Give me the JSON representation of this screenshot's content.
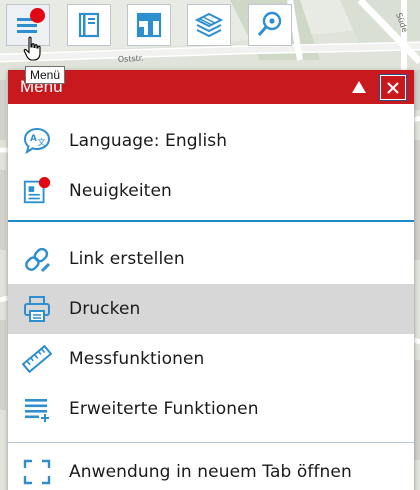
{
  "map": {
    "street_labels": [
      "Oststr.",
      "Süde"
    ]
  },
  "toolbar": {
    "buttons": [
      {
        "name": "menu",
        "icon": "hamburger-menu-icon",
        "has_badge": true
      },
      {
        "name": "legend",
        "icon": "book-icon"
      },
      {
        "name": "themes",
        "icon": "map-layout-icon"
      },
      {
        "name": "layers",
        "icon": "layers-icon"
      },
      {
        "name": "search-location",
        "icon": "search-location-icon"
      }
    ],
    "tooltip": "Menü"
  },
  "menu": {
    "title": "Menü",
    "items": [
      {
        "label": "Language: English",
        "icon": "translate-icon"
      },
      {
        "label": "Neuigkeiten",
        "icon": "news-icon",
        "has_badge": true
      },
      {
        "label": "Link erstellen",
        "icon": "link-icon"
      },
      {
        "label": "Drucken",
        "icon": "printer-icon",
        "highlighted": true
      },
      {
        "label": "Messfunktionen",
        "icon": "ruler-icon"
      },
      {
        "label": "Erweiterte Funktionen",
        "icon": "advanced-list-icon"
      },
      {
        "label": "Anwendung in neuem Tab öffnen",
        "icon": "open-new-tab-icon"
      }
    ]
  },
  "colors": {
    "header_red": "#c8191f",
    "badge_red": "#e30613",
    "icon_blue": "#2d8fd0",
    "divider_blue": "#1c8ac9",
    "highlight_gray": "#d7d7d7"
  }
}
